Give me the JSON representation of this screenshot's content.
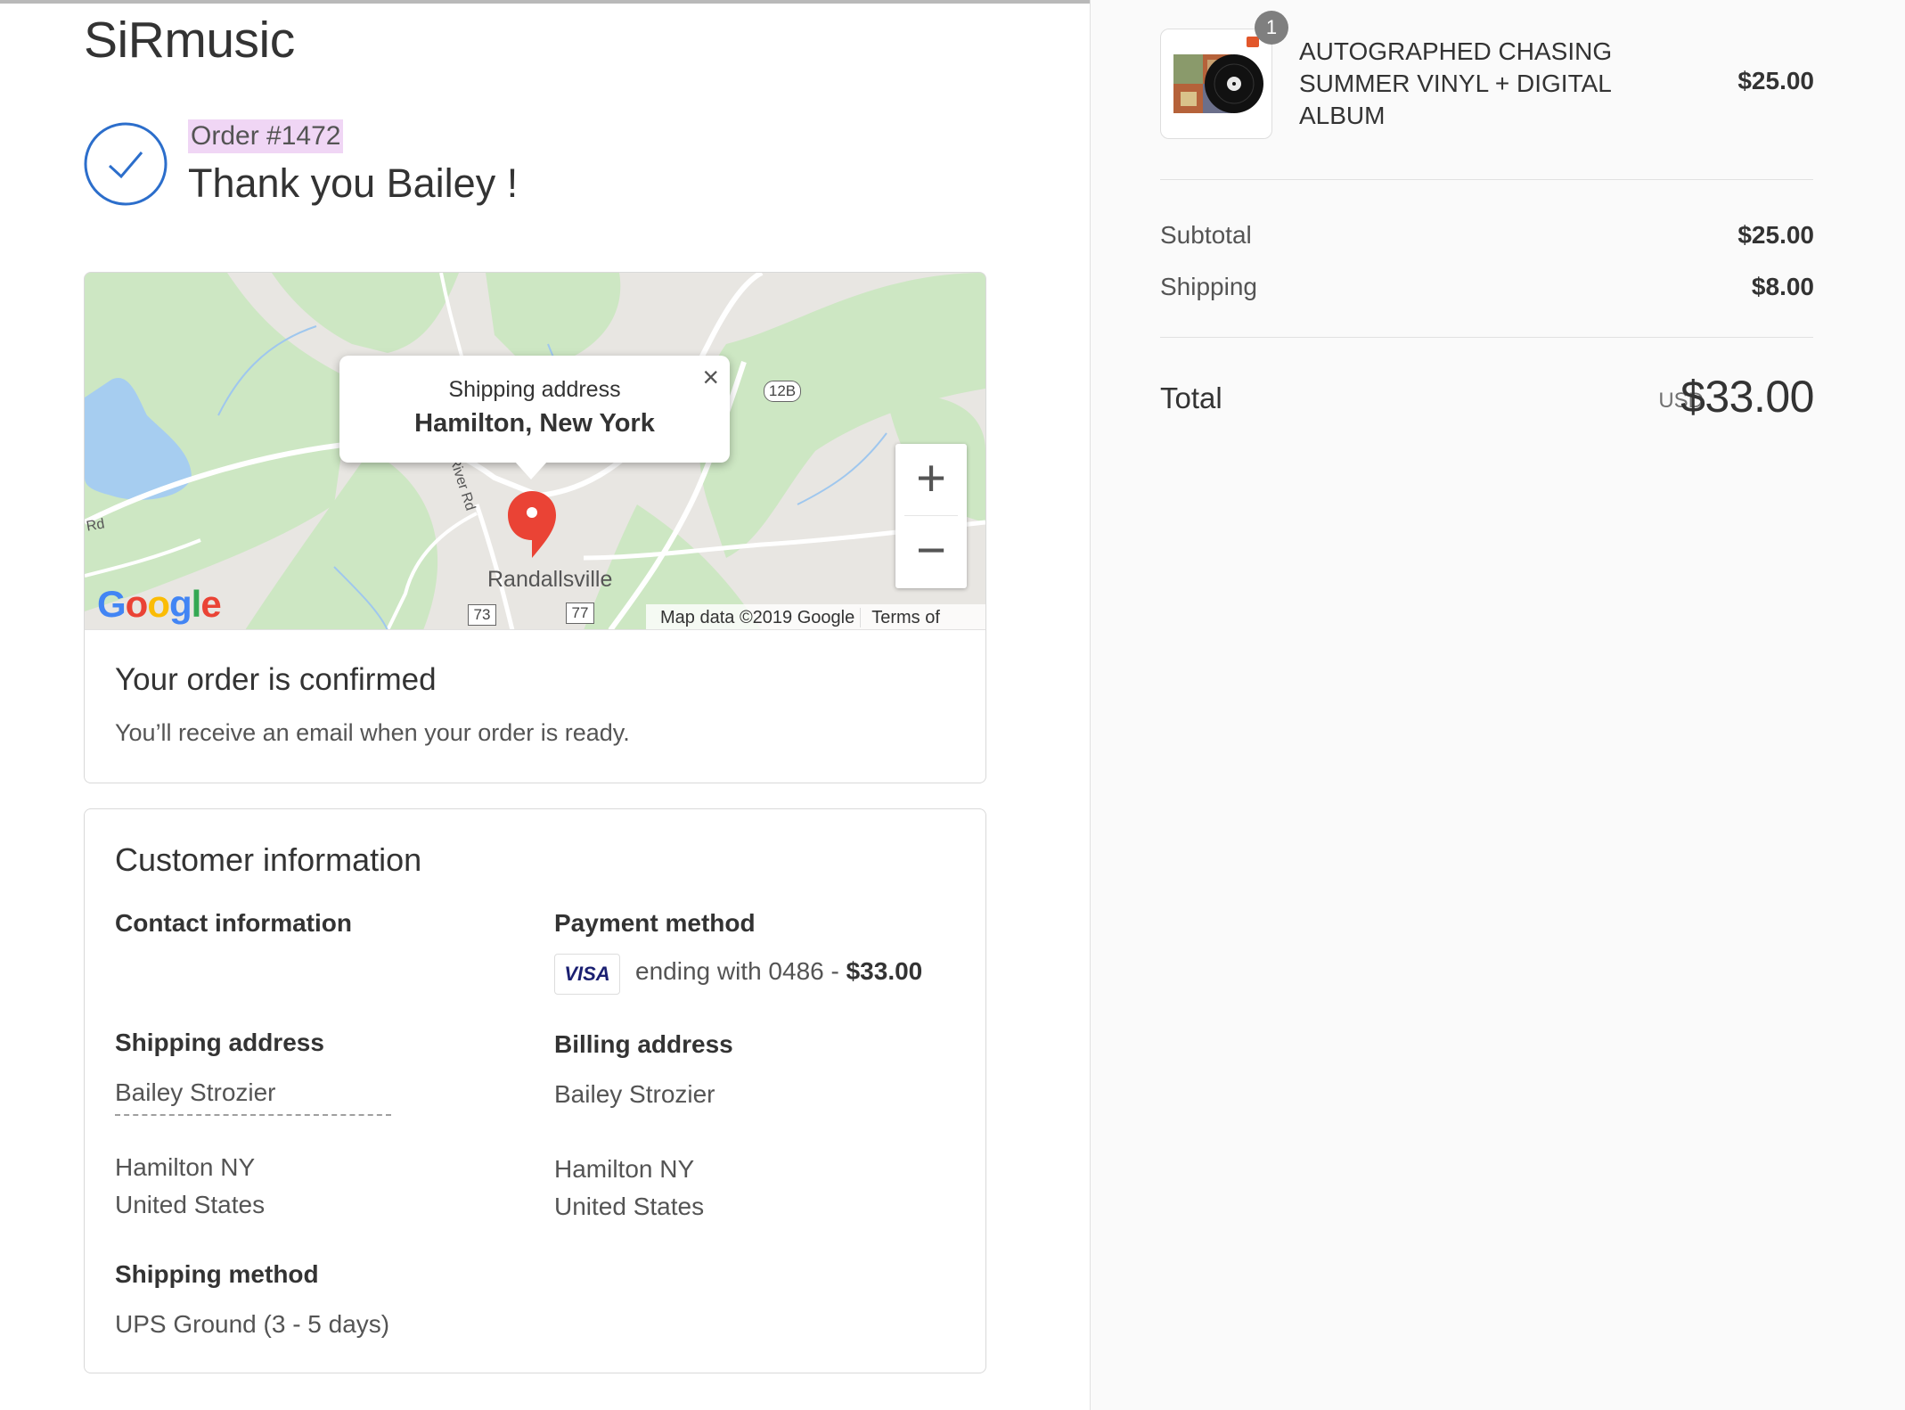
{
  "shop": {
    "name": "SiRmusic"
  },
  "order": {
    "number": "Order #1472",
    "thank_you": "Thank you Bailey !"
  },
  "map": {
    "popup_title": "Shipping address",
    "popup_address": "Hamilton, New York",
    "popup_close": "×",
    "zoom_in": "+",
    "zoom_out": "−",
    "place_name": "Randallsville",
    "road_river": "River Rd",
    "road_rd": "Rd",
    "route_128": "12B",
    "route_73": "73",
    "route_77": "77",
    "logo_letters": [
      "G",
      "o",
      "o",
      "g",
      "l",
      "e"
    ],
    "attribution": "Map data ©2019 Google",
    "terms": "Terms of Use"
  },
  "confirmation": {
    "title": "Your order is confirmed",
    "message": "You’ll receive an email when your order is ready."
  },
  "customer": {
    "title": "Customer information",
    "contact_heading": "Contact information",
    "payment_heading": "Payment method",
    "card_brand": "VISA",
    "payment_detail": "ending with 0486 - ",
    "payment_amount": "$33.00",
    "shipping_heading": "Shipping address",
    "shipping_name": "Bailey Strozier",
    "shipping_city": "Hamilton NY",
    "shipping_country": "United States",
    "billing_heading": "Billing address",
    "billing_name": "Bailey Strozier",
    "billing_city": "Hamilton NY",
    "billing_country": "United States",
    "method_heading": "Shipping method",
    "method_value": "UPS Ground (3 - 5 days)"
  },
  "summary": {
    "item_quantity": "1",
    "item_name": "AUTOGRAPHED CHASING SUMMER VINYL + DIGITAL ALBUM",
    "item_price": "$25.00",
    "subtotal_label": "Subtotal",
    "subtotal_value": "$25.00",
    "shipping_label": "Shipping",
    "shipping_value": "$8.00",
    "total_label": "Total",
    "total_currency": "USD",
    "total_value": "$33.00"
  },
  "colors": {
    "accent": "#2c6ecb",
    "order_highlight": "#f0d6f5",
    "map_pin": "#ea4335"
  }
}
